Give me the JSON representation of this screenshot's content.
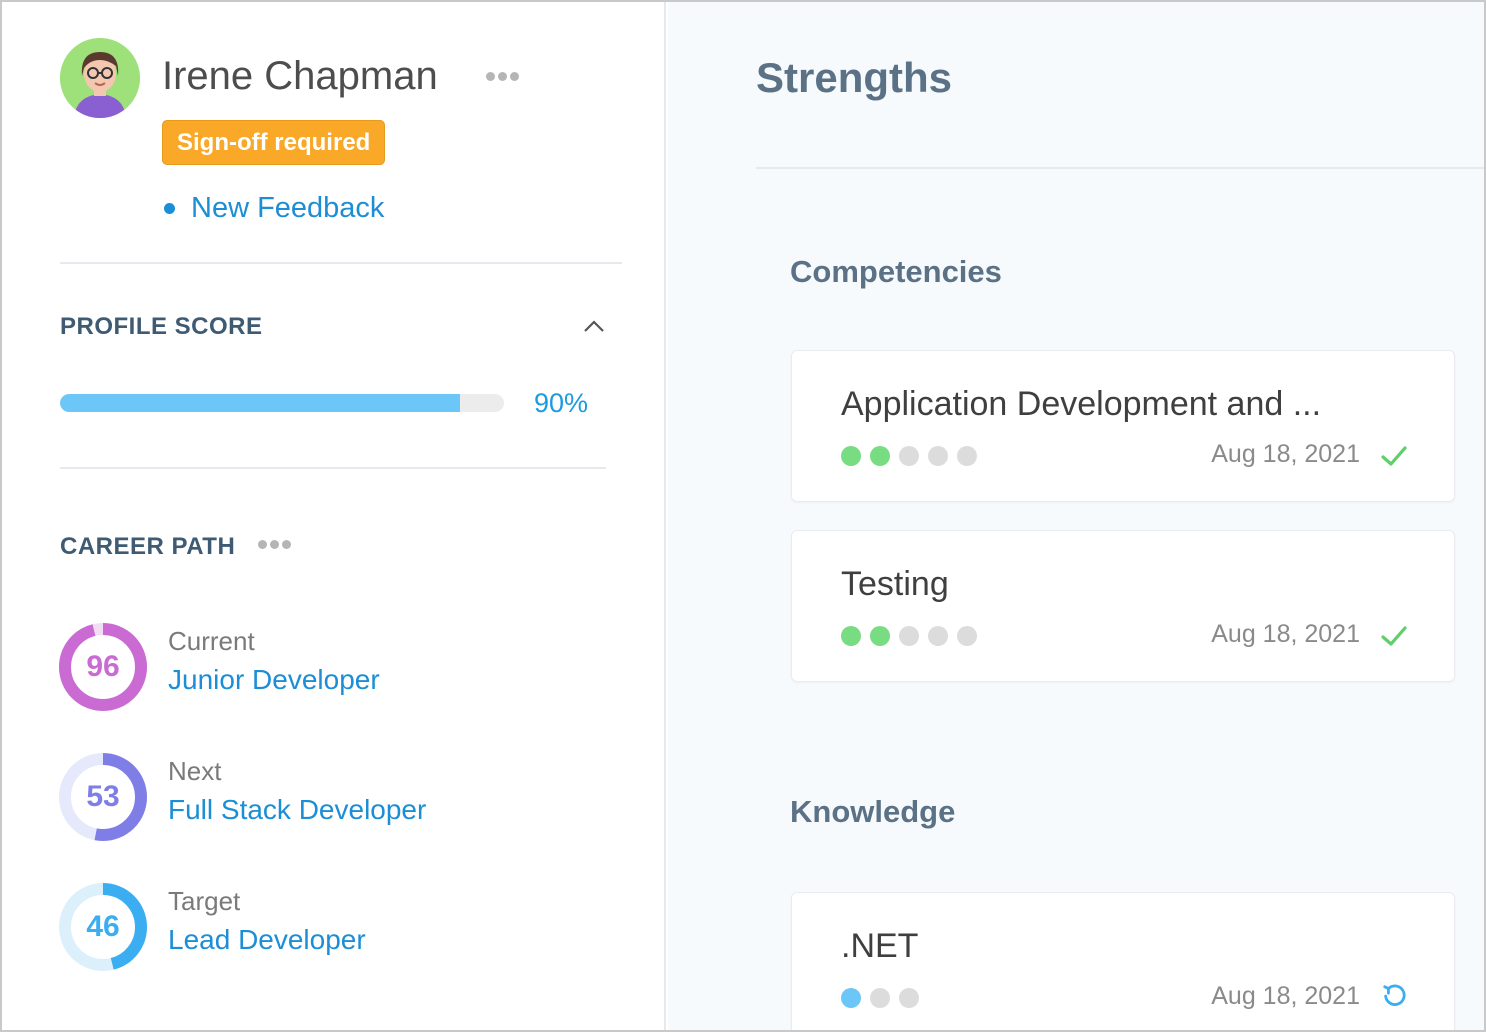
{
  "profile": {
    "name": "Irene Chapman",
    "badge": "Sign-off required",
    "feedback_link": "New Feedback",
    "accent_color": "#1c8ed6",
    "badge_color": "#f9a828"
  },
  "profile_score": {
    "title": "PROFILE SCORE",
    "percent": 90,
    "label": "90%"
  },
  "career_path": {
    "title": "CAREER PATH",
    "items": [
      {
        "kind": "Current",
        "role": "Junior Developer",
        "score": "96",
        "percent": 96,
        "color": "#c96bd3",
        "track": "#f1def4"
      },
      {
        "kind": "Next",
        "role": "Full Stack Developer",
        "score": "53",
        "percent": 53,
        "color": "#7e7ee6",
        "track": "#e6e9fb"
      },
      {
        "kind": "Target",
        "role": "Lead Developer",
        "score": "46",
        "percent": 46,
        "color": "#3aaef0",
        "track": "#dcf0fc"
      }
    ]
  },
  "strengths": {
    "title": "Strengths",
    "competencies": {
      "title": "Competencies",
      "items": [
        {
          "name": "Application Development and ...",
          "rating": 2,
          "scale": 5,
          "date": "Aug 18, 2021",
          "status": "check-icon",
          "dot_color": "#77dc82"
        },
        {
          "name": "Testing",
          "rating": 2,
          "scale": 5,
          "date": "Aug 18, 2021",
          "status": "check-icon",
          "dot_color": "#77dc82"
        }
      ]
    },
    "knowledge": {
      "title": "Knowledge",
      "items": [
        {
          "name": ".NET",
          "rating": 1,
          "scale": 3,
          "date": "Aug 18, 2021",
          "status": "refresh-icon",
          "dot_color": "#6cc6f8"
        }
      ]
    }
  }
}
